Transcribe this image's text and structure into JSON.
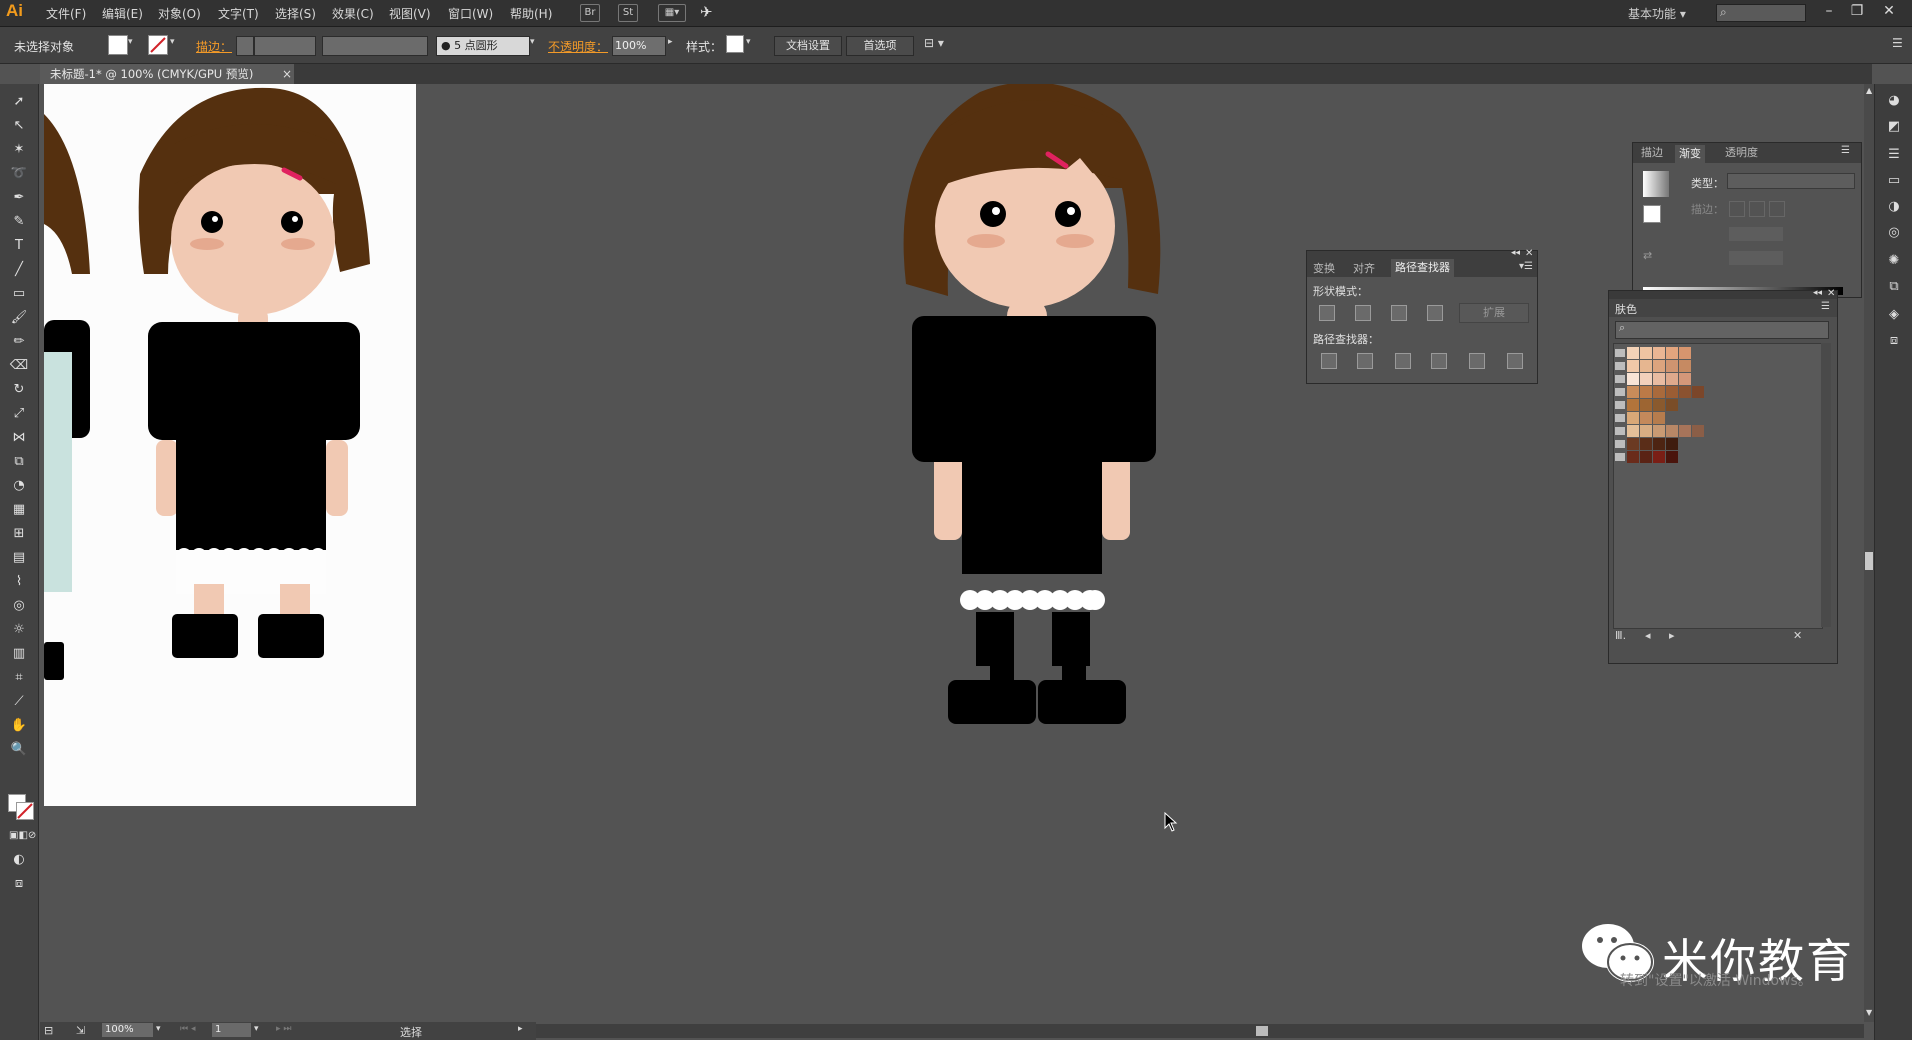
{
  "app": {
    "logo": "Ai"
  },
  "menu": [
    "文件(F)",
    "编辑(E)",
    "对象(O)",
    "文字(T)",
    "选择(S)",
    "效果(C)",
    "视图(V)",
    "窗口(W)",
    "帮助(H)"
  ],
  "menubar_icons": {
    "br": "Br",
    "st": "St"
  },
  "workspace": "基本功能",
  "control_bar": {
    "selection_label": "未选择对象",
    "stroke_label": "描边：",
    "brush_label": "● 5 点圆形",
    "opacity_label": "不透明度：",
    "opacity_value": "100%",
    "style_label": "样式：",
    "doc_setup_button": "文档设置",
    "prefs_button": "首选项"
  },
  "document_tab": {
    "title": "未标题-1* @ 100% (CMYK/GPU 预览)",
    "close": "×"
  },
  "pathfinder_panel": {
    "tabs": [
      "变换",
      "对齐",
      "路径查找器"
    ],
    "active_tab": "路径查找器",
    "shape_modes_label": "形状模式：",
    "expand_button": "扩展",
    "pathfinders_label": "路径查找器："
  },
  "gradient_panel": {
    "tabs": [
      "描边",
      "渐变",
      "透明度"
    ],
    "active_tab": "渐变",
    "type_label": "类型：",
    "stroke_label": "描边："
  },
  "swatches_panel": {
    "title": "肤色",
    "rows": [
      [
        "#f3d2b7",
        "#efc4a2",
        "#eab694",
        "#e3a57e",
        "#d7956e"
      ],
      [
        "#f0c8a8",
        "#e6b690",
        "#dca47e",
        "#cf9470",
        "#c68a62"
      ],
      [
        "#f8e4d6",
        "#f2d0bb",
        "#e8bca2",
        "#dea98c",
        "#d49779"
      ],
      [
        "#c98c5a",
        "#bb7a47",
        "#a96a3c",
        "#9b5d34",
        "#8b5230",
        "#7b462a"
      ],
      [
        "#b2743b",
        "#9d6532",
        "#8a5a2e",
        "#7a4d28"
      ],
      [
        "#d9a877",
        "#c4895b",
        "#b67c4d"
      ],
      [
        "#e4bf98",
        "#d8ad83",
        "#c99a73",
        "#b88766",
        "#a7745a",
        "#8b5e47"
      ],
      [
        "#6b3a22",
        "#5a2d18",
        "#4d2412",
        "#3f1c0e"
      ],
      [
        "#6a2b1b",
        "#5a2315",
        "#7a1e15",
        "#4a140c"
      ]
    ]
  },
  "status_bar": {
    "zoom": "100%",
    "page": "1",
    "mode": "选择"
  },
  "watermark": {
    "text": "米你教育",
    "sub": "转到\"设置\"以激活 Windows。"
  },
  "colors": {
    "hair": "#55300f",
    "skin": "#f1c9b3",
    "blush": "#e5a98f",
    "clip": "#e0225f",
    "dress": "#000000",
    "lace": "#ffffff"
  }
}
